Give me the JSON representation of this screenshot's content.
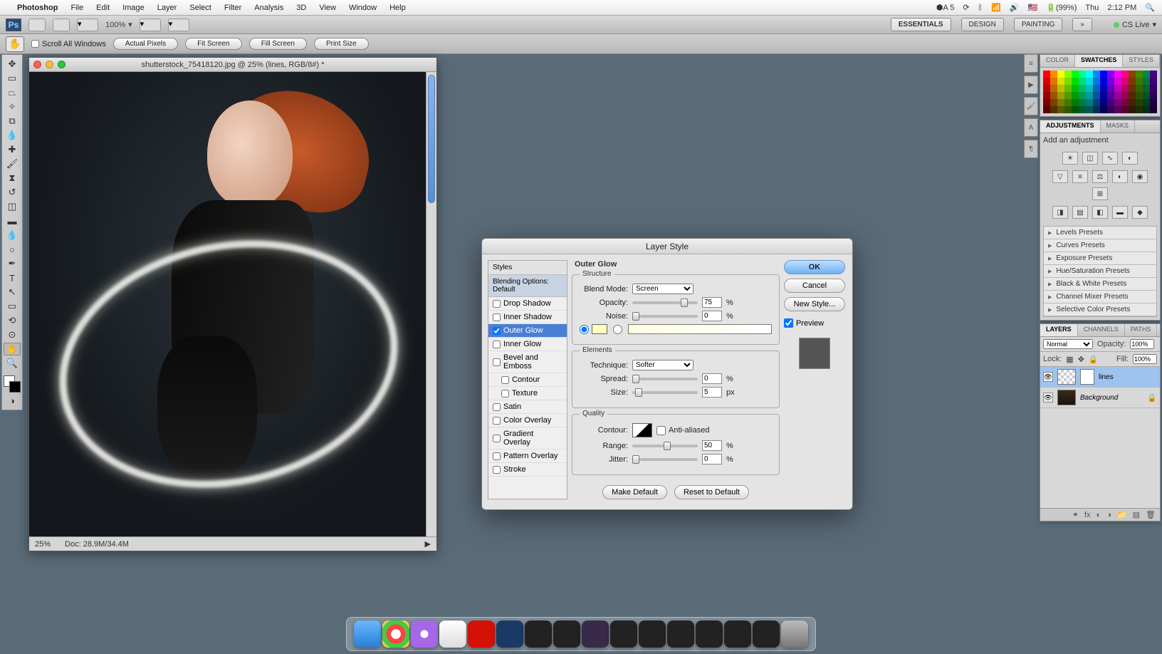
{
  "menubar": {
    "app": "Photoshop",
    "items": [
      "File",
      "Edit",
      "Image",
      "Layer",
      "Select",
      "Filter",
      "Analysis",
      "3D",
      "View",
      "Window",
      "Help"
    ],
    "right": {
      "battery": "(99%)",
      "day": "Thu",
      "time": "2:12 PM",
      "adobe": "A 5"
    }
  },
  "appbar": {
    "zoom": "100%",
    "workspaces": [
      "ESSENTIALS",
      "DESIGN",
      "PAINTING"
    ],
    "cslive": "CS Live"
  },
  "options": {
    "scroll_all": "Scroll All Windows",
    "buttons": [
      "Actual Pixels",
      "Fit Screen",
      "Fill Screen",
      "Print Size"
    ]
  },
  "doc": {
    "title": "shutterstock_75418120.jpg @ 25% (lines, RGB/8#) *",
    "zoom": "25%",
    "info": "Doc: 28.9M/34.4M"
  },
  "panels": {
    "color_tabs": [
      "COLOR",
      "SWATCHES",
      "STYLES"
    ],
    "adjust_tabs": [
      "ADJUSTMENTS",
      "MASKS"
    ],
    "adjust_hint": "Add an adjustment",
    "presets": [
      "Levels Presets",
      "Curves Presets",
      "Exposure Presets",
      "Hue/Saturation Presets",
      "Black & White Presets",
      "Channel Mixer Presets",
      "Selective Color Presets"
    ],
    "layers_tabs": [
      "LAYERS",
      "CHANNELS",
      "PATHS"
    ],
    "blend": "Normal",
    "opacity_lbl": "Opacity:",
    "opacity": "100%",
    "lock_lbl": "Lock:",
    "fill_lbl": "Fill:",
    "fill": "100%",
    "layers": [
      {
        "name": "lines"
      },
      {
        "name": "Background"
      }
    ]
  },
  "dialog": {
    "title": "Layer Style",
    "styles_header": "Styles",
    "blending": "Blending Options: Default",
    "styles": [
      "Drop Shadow",
      "Inner Shadow",
      "Outer Glow",
      "Inner Glow",
      "Bevel and Emboss",
      "Contour",
      "Texture",
      "Satin",
      "Color Overlay",
      "Gradient Overlay",
      "Pattern Overlay",
      "Stroke"
    ],
    "section": "Outer Glow",
    "structure": "Structure",
    "blend_mode_lbl": "Blend Mode:",
    "blend_mode": "Screen",
    "opacity_lbl": "Opacity:",
    "opacity": "75",
    "pct": "%",
    "noise_lbl": "Noise:",
    "noise": "0",
    "elements": "Elements",
    "technique_lbl": "Technique:",
    "technique": "Softer",
    "spread_lbl": "Spread:",
    "spread": "0",
    "size_lbl": "Size:",
    "size": "5",
    "px": "px",
    "quality": "Quality",
    "contour_lbl": "Contour:",
    "anti": "Anti-aliased",
    "range_lbl": "Range:",
    "range": "50",
    "jitter_lbl": "Jitter:",
    "jitter": "0",
    "make_default": "Make Default",
    "reset_default": "Reset to Default",
    "ok": "OK",
    "cancel": "Cancel",
    "new_style": "New Style...",
    "preview": "Preview"
  },
  "dock": [
    "finder",
    "chrome",
    "itunes",
    "ical",
    "lastfm",
    "ps",
    "mon",
    "mon",
    "ae",
    "mon",
    "mon",
    "mon",
    "mon",
    "mon",
    "mon",
    "trash"
  ]
}
